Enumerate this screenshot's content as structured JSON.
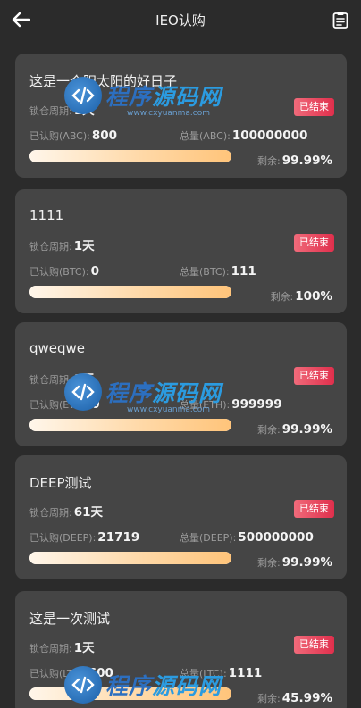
{
  "header": {
    "title": "IEO认购",
    "back_icon": "arrow-left-icon",
    "record_icon": "clipboard-icon"
  },
  "labels": {
    "lock_period": "锁仓周期:",
    "remaining": "剩余:"
  },
  "colors": {
    "background": "#2b2b2b",
    "card": "#454545",
    "badge_start": "#f06a7a",
    "badge_end": "#e02f4c",
    "progress_start": "#fff6ea",
    "progress_end": "#ffc47a"
  },
  "items": [
    {
      "name": "这是一个阳太阳的好日子",
      "lock_value": "1天",
      "status": "已结束",
      "subscribed_label": "已认购(ABC):",
      "subscribed_value": "800",
      "total_label": "总量(ABC):",
      "total_value": "100000000",
      "remaining_value": "99.99%",
      "progress": 1
    },
    {
      "name": "1111",
      "lock_value": "1天",
      "status": "已结束",
      "subscribed_label": "已认购(BTC):",
      "subscribed_value": "0",
      "total_label": "总量(BTC):",
      "total_value": "111",
      "remaining_value": "100%",
      "progress": 1
    },
    {
      "name": "qweqwe",
      "lock_value": "1天",
      "status": "已结束",
      "subscribed_label": "已认购(ETH):",
      "subscribed_value": "0",
      "total_label": "总量(ETH):",
      "total_value": "999999",
      "remaining_value": "99.99%",
      "progress": 1
    },
    {
      "name": "DEEP测试",
      "lock_value": "61天",
      "status": "已结束",
      "subscribed_label": "已认购(DEEP):",
      "subscribed_value": "21719",
      "total_label": "总量(DEEP):",
      "total_value": "500000000",
      "remaining_value": "99.99%",
      "progress": 1
    },
    {
      "name": "这是一次测试",
      "lock_value": "1天",
      "status": "已结束",
      "subscribed_label": "已认购(LTC):",
      "subscribed_value": "600",
      "total_label": "总量(LTC):",
      "total_value": "1111",
      "remaining_value": "45.99%",
      "progress": 1
    }
  ],
  "watermark": {
    "text_a": "程序",
    "text_b": "源码网",
    "subtext": "www.cxyuanma.com",
    "icon": "code-logo-icon"
  }
}
